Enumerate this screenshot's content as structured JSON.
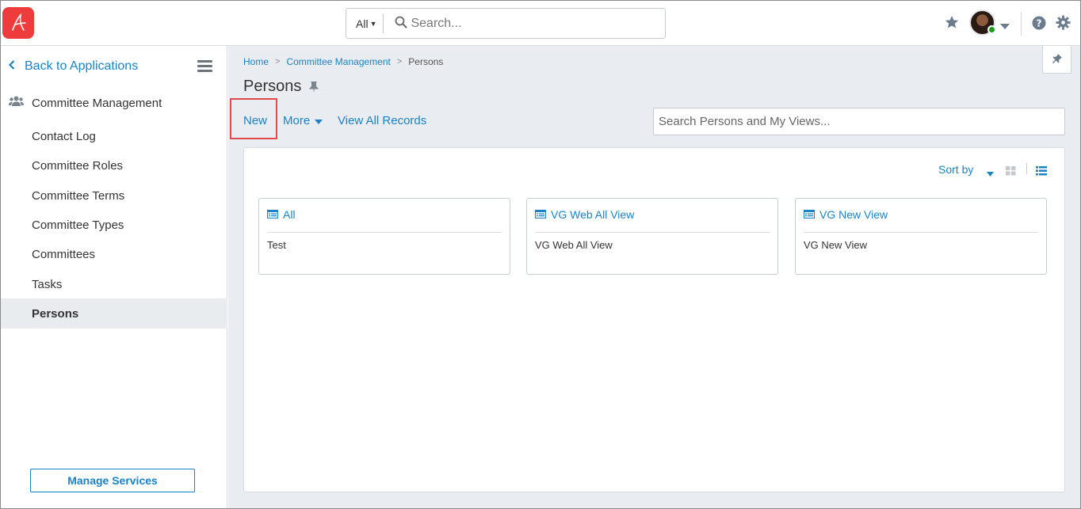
{
  "topbar": {
    "search_scope": "All",
    "search_placeholder": "Search..."
  },
  "sidebar": {
    "back_label": "Back to Applications",
    "group_label": "Committee Management",
    "items": [
      {
        "label": "Contact Log"
      },
      {
        "label": "Committee Roles"
      },
      {
        "label": "Committee Terms"
      },
      {
        "label": "Committee Types"
      },
      {
        "label": "Committees"
      },
      {
        "label": "Tasks"
      },
      {
        "label": "Persons",
        "active": true
      }
    ],
    "manage_button": "Manage Services"
  },
  "breadcrumb": {
    "home": "Home",
    "parent": "Committee Management",
    "current": "Persons"
  },
  "page": {
    "title": "Persons",
    "actions": {
      "new": "New",
      "more": "More",
      "view_all": "View All Records"
    },
    "views_search_placeholder": "Search Persons and My Views...",
    "sort_label": "Sort by"
  },
  "cards": [
    {
      "title": "All",
      "body": "Test"
    },
    {
      "title": "VG Web All View",
      "body": "VG Web All View"
    },
    {
      "title": "VG New View",
      "body": "VG New View"
    }
  ],
  "colors": {
    "accent": "#1a83c6",
    "logo": "#ee3b3b",
    "highlight": "#e04a4a",
    "presence": "#1c9b1c"
  },
  "icons": [
    "app-logo-icon",
    "search-icon",
    "star-icon",
    "help-icon",
    "gear-icon",
    "chevron-left-icon",
    "menu-icon",
    "people-icon",
    "pin-icon",
    "caret-down-icon",
    "grid-view-icon",
    "list-view-icon",
    "view-list-icon"
  ]
}
